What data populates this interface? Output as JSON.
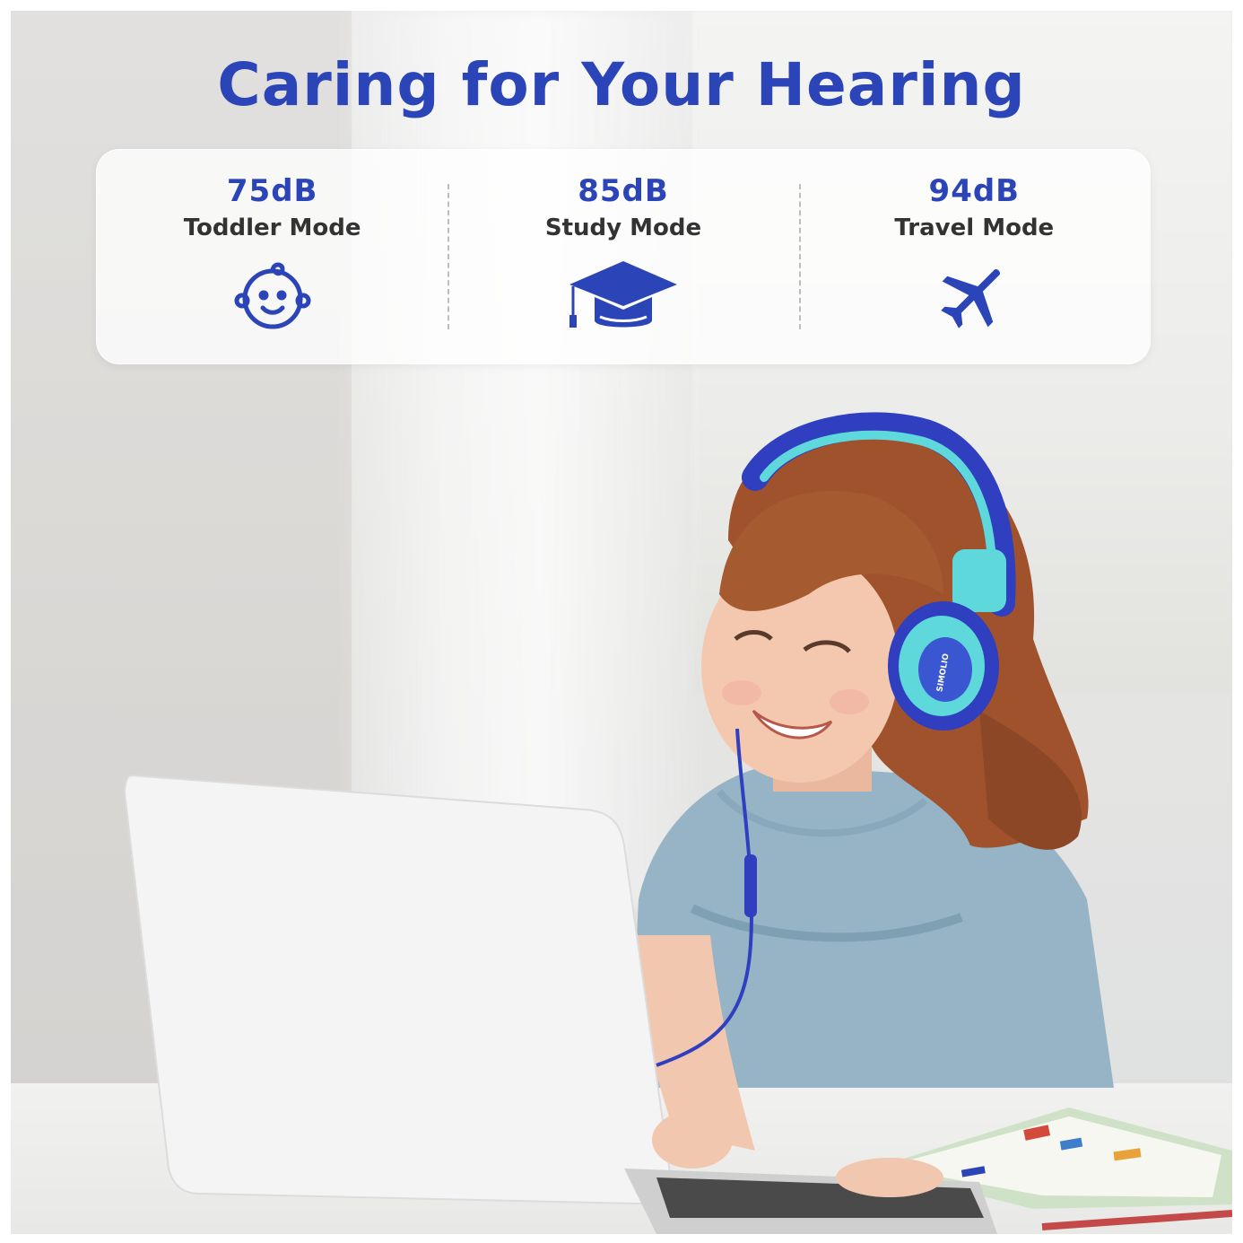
{
  "title": "Caring for Your Hearing",
  "modes": [
    {
      "db": "75dB",
      "label": "Toddler Mode",
      "icon": "baby-face-icon"
    },
    {
      "db": "85dB",
      "label": "Study Mode",
      "icon": "graduation-cap-icon"
    },
    {
      "db": "94dB",
      "label": "Travel Mode",
      "icon": "airplane-icon"
    }
  ],
  "headphone_brand": "SIMOLIO",
  "colors": {
    "title": "#2b45b8",
    "icon": "#2b45b8",
    "label": "#333333",
    "headphone_blue": "#2f3fc0",
    "headphone_teal": "#5fd8dc"
  }
}
